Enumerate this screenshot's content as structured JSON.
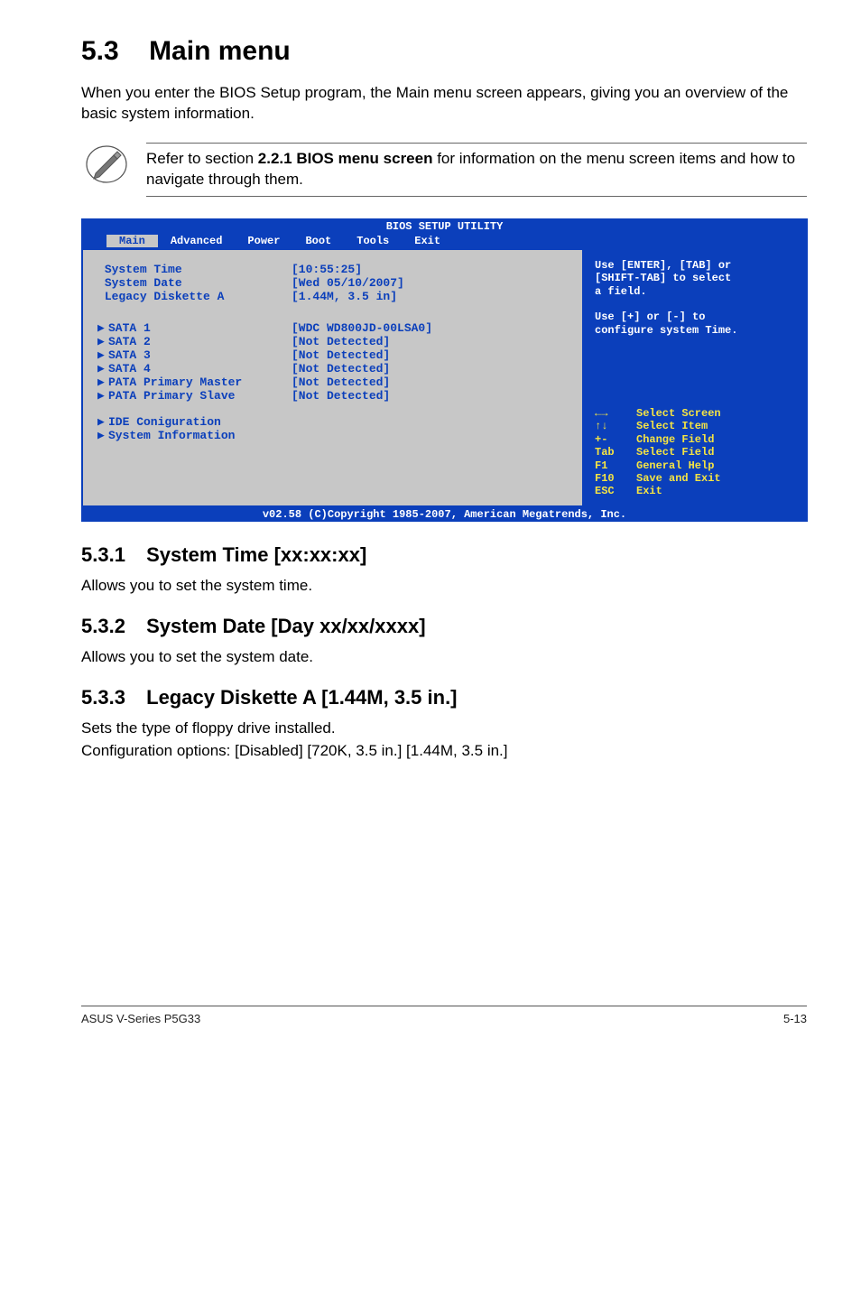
{
  "heading": {
    "num": "5.3",
    "title": "Main menu"
  },
  "intro": "When you enter the BIOS Setup program, the Main menu screen appears, giving you an overview of the basic system information.",
  "note": {
    "pre": "Refer to section ",
    "bold": "2.2.1  BIOS menu screen",
    "post": " for information on the menu screen items and how to navigate through them."
  },
  "bios": {
    "title": "BIOS SETUP UTILITY",
    "tabs": [
      "Main",
      "Advanced",
      "Power",
      "Boot",
      "Tools",
      "Exit"
    ],
    "active_tab": "Main",
    "rows": [
      {
        "k": "System Time",
        "v": "[10:55:25]",
        "arrow": false
      },
      {
        "k": "System Date",
        "v": "[Wed 05/10/2007]",
        "arrow": false
      },
      {
        "k": "Legacy Diskette A",
        "v": "[1.44M, 3.5 in]",
        "arrow": false
      }
    ],
    "sata": [
      {
        "k": "SATA 1",
        "v": "[WDC WD800JD-00LSA0]",
        "arrow": true
      },
      {
        "k": "SATA 2",
        "v": "[Not Detected]",
        "arrow": true
      },
      {
        "k": "SATA 3",
        "v": "[Not Detected]",
        "arrow": true
      },
      {
        "k": "SATA 4",
        "v": "[Not Detected]",
        "arrow": true
      },
      {
        "k": "PATA Primary Master",
        "v": "[Not Detected]",
        "arrow": true
      },
      {
        "k": "PATA Primary Slave",
        "v": "[Not Detected]",
        "arrow": true
      }
    ],
    "extra": [
      {
        "k": "IDE Coniguration",
        "arrow": true
      },
      {
        "k": "System Information",
        "arrow": true
      }
    ],
    "help_lines": [
      "Use [ENTER], [TAB] or",
      "[SHIFT-TAB] to select",
      "a field.",
      "",
      "Use [+] or [-] to",
      "configure system Time."
    ],
    "legend": [
      {
        "k": "←→",
        "v": "Select Screen"
      },
      {
        "k": "↑↓",
        "v": "Select Item"
      },
      {
        "k": "+-",
        "v": "Change Field"
      },
      {
        "k": "Tab",
        "v": "Select Field"
      },
      {
        "k": "F1",
        "v": "General Help"
      },
      {
        "k": "F10",
        "v": "Save and Exit"
      },
      {
        "k": "ESC",
        "v": "Exit"
      }
    ],
    "footer": "v02.58 (C)Copyright 1985-2007, American Megatrends, Inc."
  },
  "subs": [
    {
      "num": "5.3.1",
      "title": "System Time [xx:xx:xx]",
      "body": "Allows you to set the system time."
    },
    {
      "num": "5.3.2",
      "title": "System Date [Day xx/xx/xxxx]",
      "body": "Allows you to set the system date."
    },
    {
      "num": "5.3.3",
      "title": "Legacy Diskette A [1.44M, 3.5 in.]",
      "body": "Sets the type of floppy drive installed.",
      "body2": "Configuration options: [Disabled] [720K, 3.5 in.] [1.44M, 3.5 in.]"
    }
  ],
  "footer": {
    "left": "ASUS V-Series P5G33",
    "right": "5-13"
  }
}
